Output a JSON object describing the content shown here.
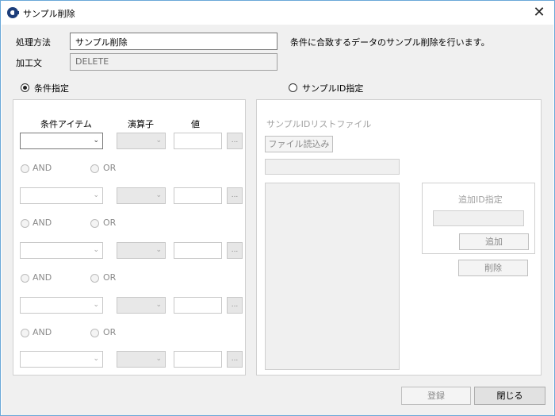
{
  "window": {
    "title": "サンプル削除"
  },
  "form": {
    "method_label": "処理方法",
    "method_value": "サンプル削除",
    "description": "条件に合致するデータのサンプル削除を行います。",
    "sentence_label": "加工文",
    "sentence_value": "DELETE"
  },
  "modes": {
    "condition_label": "条件指定",
    "condition_selected": true,
    "sample_id_label": "サンプルID指定",
    "sample_id_selected": false
  },
  "conditions": {
    "headers": {
      "item": "条件アイテム",
      "operator": "演算子",
      "value": "値"
    },
    "dots_label": "...",
    "and_label": "AND",
    "or_label": "OR",
    "row_count": 5
  },
  "sample_id_panel": {
    "list_file_label": "サンプルIDリストファイル",
    "read_file_button": "ファイル読込み",
    "add_id_label": "追加ID指定",
    "add_button": "追加",
    "delete_button": "削除"
  },
  "footer": {
    "register_button": "登録",
    "close_button": "閉じる"
  }
}
